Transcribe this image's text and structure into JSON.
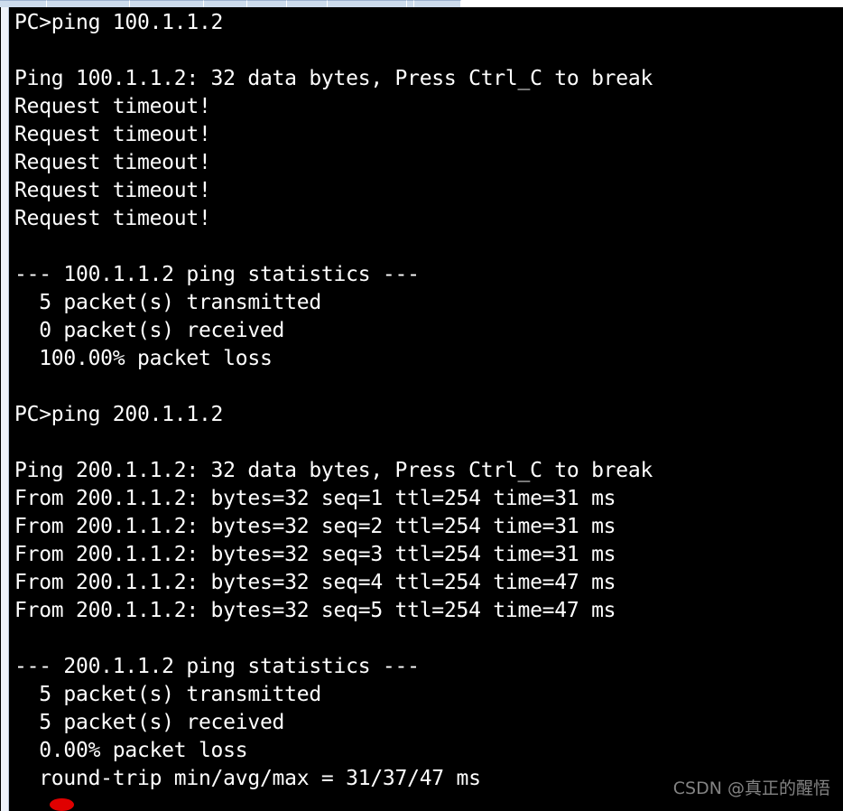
{
  "window": {
    "type": "terminal-console",
    "background_color": "#000000",
    "text_color": "#ffffff",
    "border_color": "#eff3fa"
  },
  "tabstrip": {
    "visible_fragment": true,
    "tab_color": "#cddced",
    "tabs": [
      "",
      "",
      "",
      "",
      "",
      "",
      "",
      "",
      ""
    ]
  },
  "console": {
    "prompt": "PC>",
    "lines": [
      "PC>ping 100.1.1.2",
      "",
      "Ping 100.1.1.2: 32 data bytes, Press Ctrl_C to break",
      "Request timeout!",
      "Request timeout!",
      "Request timeout!",
      "Request timeout!",
      "Request timeout!",
      "",
      "--- 100.1.1.2 ping statistics ---",
      "  5 packet(s) transmitted",
      "  0 packet(s) received",
      "  100.00% packet loss",
      "",
      "PC>ping 200.1.1.2",
      "",
      "Ping 200.1.1.2: 32 data bytes, Press Ctrl_C to break",
      "From 200.1.1.2: bytes=32 seq=1 ttl=254 time=31 ms",
      "From 200.1.1.2: bytes=32 seq=2 ttl=254 time=31 ms",
      "From 200.1.1.2: bytes=32 seq=3 ttl=254 time=31 ms",
      "From 200.1.1.2: bytes=32 seq=4 ttl=254 time=47 ms",
      "From 200.1.1.2: bytes=32 seq=5 ttl=254 time=47 ms",
      "",
      "--- 200.1.1.2 ping statistics ---",
      "  5 packet(s) transmitted",
      "  5 packet(s) received",
      "  0.00% packet loss",
      "  round-trip min/avg/max = 31/37/47 ms"
    ],
    "sessions": [
      {
        "command": "ping 100.1.1.2",
        "target": "100.1.1.2",
        "data_bytes": 32,
        "break_hint": "Press Ctrl_C to break",
        "replies": [],
        "timeouts": 5,
        "statistics": {
          "header": "--- 100.1.1.2 ping statistics ---",
          "transmitted": 5,
          "received": 0,
          "packet_loss": "100.00%",
          "round_trip": null
        }
      },
      {
        "command": "ping 200.1.1.2",
        "target": "200.1.1.2",
        "data_bytes": 32,
        "break_hint": "Press Ctrl_C to break",
        "replies": [
          {
            "from": "200.1.1.2",
            "bytes": 32,
            "seq": 1,
            "ttl": 254,
            "time_ms": 31
          },
          {
            "from": "200.1.1.2",
            "bytes": 32,
            "seq": 2,
            "ttl": 254,
            "time_ms": 31
          },
          {
            "from": "200.1.1.2",
            "bytes": 32,
            "seq": 3,
            "ttl": 254,
            "time_ms": 31
          },
          {
            "from": "200.1.1.2",
            "bytes": 32,
            "seq": 4,
            "ttl": 254,
            "time_ms": 47
          },
          {
            "from": "200.1.1.2",
            "bytes": 32,
            "seq": 5,
            "ttl": 254,
            "time_ms": 47
          }
        ],
        "timeouts": 0,
        "statistics": {
          "header": "--- 200.1.1.2 ping statistics ---",
          "transmitted": 5,
          "received": 5,
          "packet_loss": "0.00%",
          "round_trip": "round-trip min/avg/max = 31/37/47 ms"
        }
      }
    ]
  },
  "annotation": {
    "dot_color": "#e00000",
    "shape": "ellipse"
  },
  "watermark": {
    "text": "CSDN @真正的醒悟",
    "color": "#9a9a9a"
  }
}
